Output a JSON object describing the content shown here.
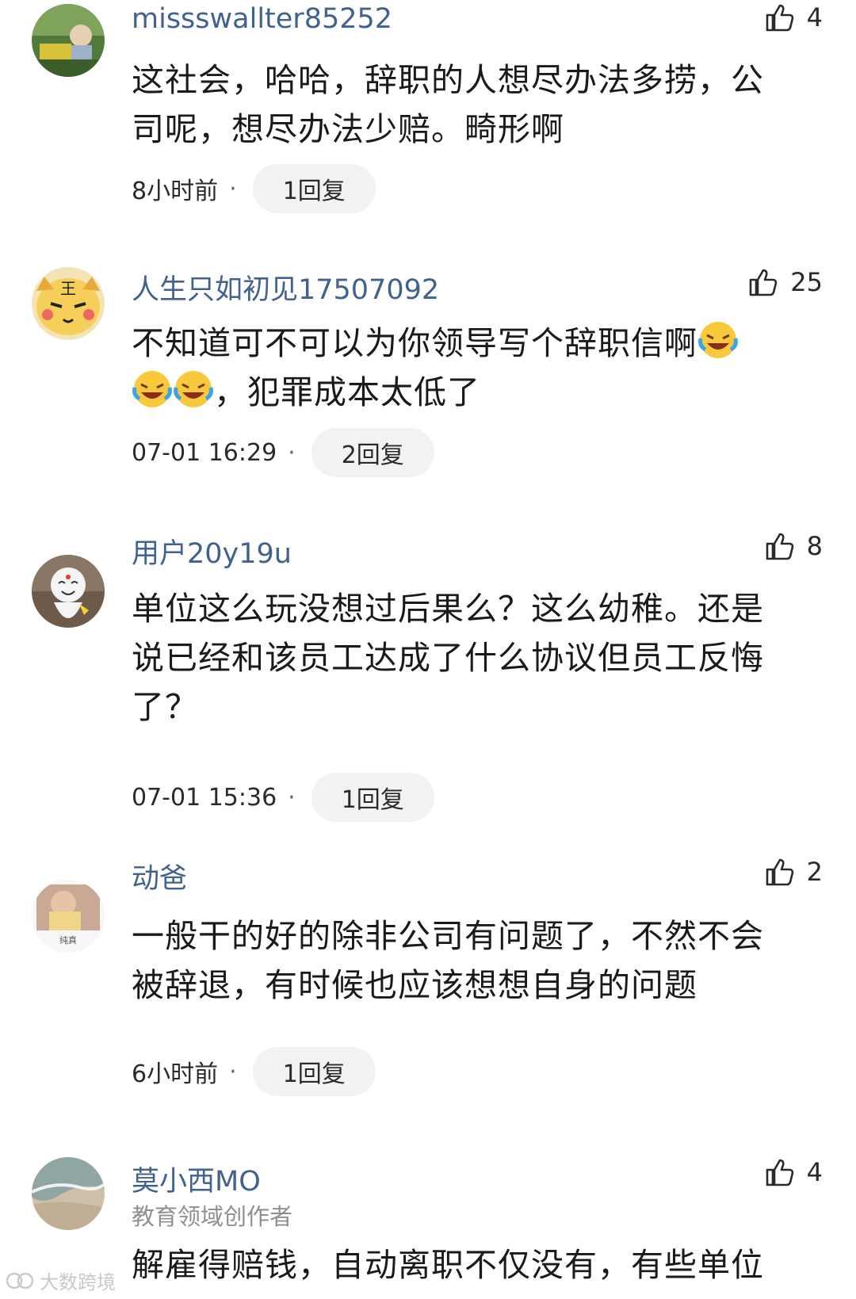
{
  "comments": [
    {
      "username": "missswallter85252",
      "likes": "4",
      "text_lines": [
        "这社会，哈哈，辞职的人想尽办法多捞，公",
        "司呢，想尽办法少赔。畸形啊"
      ],
      "time": "8小时前",
      "replies": "1回复",
      "avatar": "photo-child-avatar"
    },
    {
      "username": "人生只如初见17507092",
      "likes": "25",
      "text_line1": "不知道可不可以为你领导写个辞职信啊",
      "text_line2": "，犯罪成本太低了",
      "emoji": "laughing-crying-emoji",
      "time": "07-01 16:29",
      "replies": "2回复",
      "avatar": "cartoon-cat-avatar"
    },
    {
      "username": "用户20y19u",
      "likes": "8",
      "text_lines": [
        "单位这么玩没想过后果么？这么幼稚。还是",
        "说已经和该员工达成了什么协议但员工反悔",
        "了？"
      ],
      "time": "07-01 15:36",
      "replies": "1回复",
      "avatar": "white-doll-avatar"
    },
    {
      "username": "动爸",
      "likes": "2",
      "text_lines": [
        "一般干的好的除非公司有问题了，不然不会",
        "被辞退，有时候也应该想想自身的问题"
      ],
      "time": "6小时前",
      "replies": "1回复",
      "avatar": "photo-card-avatar",
      "avatar_caption": "纯真"
    },
    {
      "username": "莫小西MO",
      "subtitle": "教育领域创作者",
      "likes": "4",
      "text_lines": [
        "解雇得赔钱，自动离职不仅没有，有些单位"
      ],
      "avatar": "beach-photo-avatar"
    }
  ],
  "watermark": "大数跨境",
  "colors": {
    "username": "#41618f",
    "reply_bg": "#f2f2f2",
    "meta": "#2a2a2a"
  },
  "icons": {
    "like": "thumbs-up-icon"
  }
}
